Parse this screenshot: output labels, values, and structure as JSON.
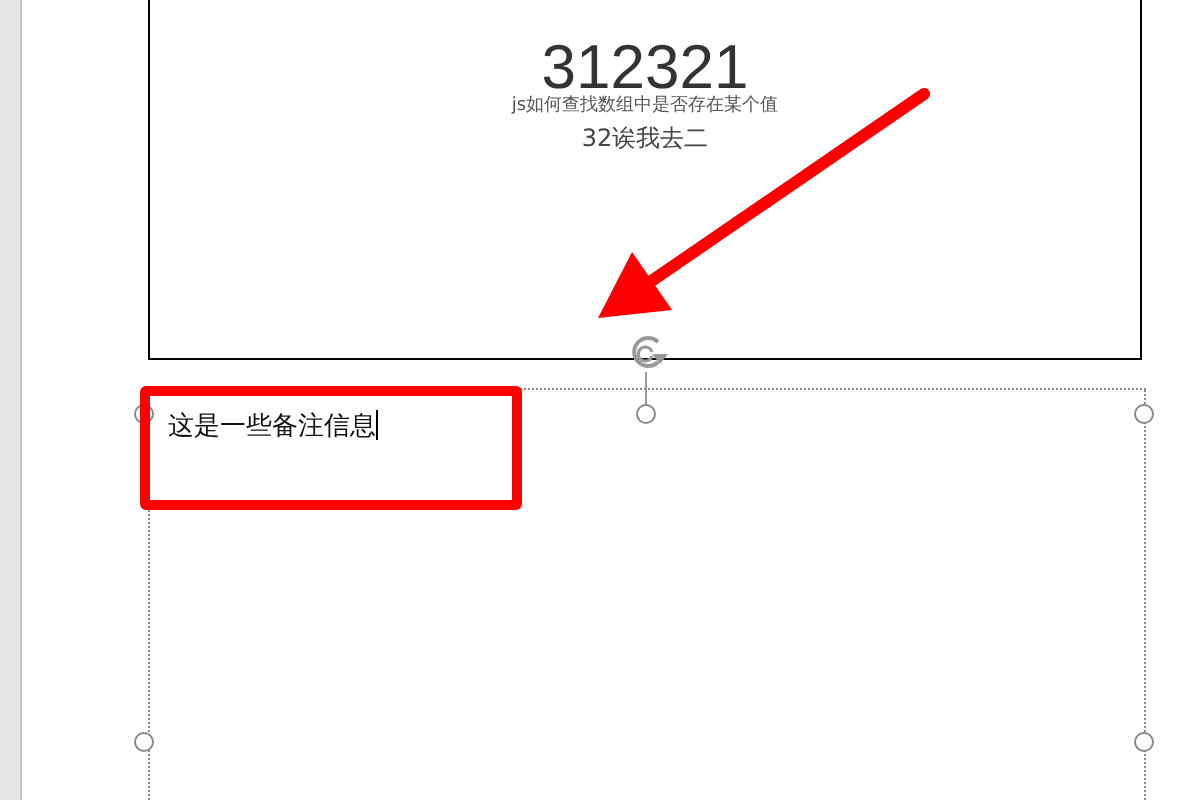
{
  "slide": {
    "title": "312321",
    "subtitle": "js如何查找数组中是否存在某个值",
    "body": "32诶我去二"
  },
  "notes": {
    "text": "这是一些备注信息",
    "editing": true,
    "selected": true
  },
  "arrow": {
    "color": "#ff0000"
  },
  "highlight": {
    "color": "#ff0000"
  }
}
